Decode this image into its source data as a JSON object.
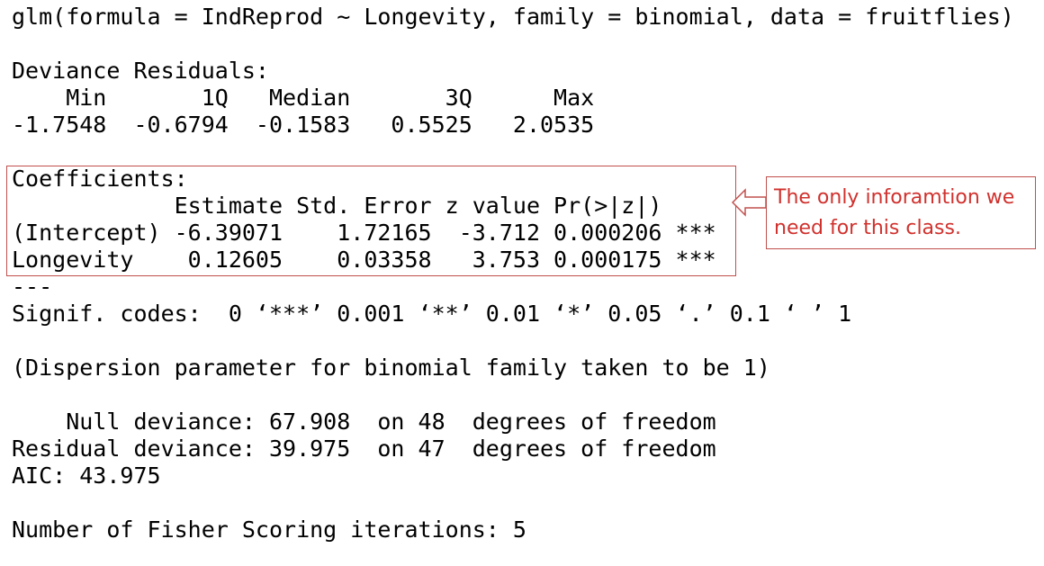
{
  "console": {
    "lines": [
      "glm(formula = IndReprod ~ Longevity, family = binomial, data = fruitflies)",
      "",
      "Deviance Residuals:",
      "    Min       1Q   Median       3Q      Max",
      "-1.7548  -0.6794  -0.1583   0.5525   2.0535",
      "",
      "Coefficients:",
      "            Estimate Std. Error z value Pr(>|z|)",
      "(Intercept) -6.39071    1.72165  -3.712 0.000206 ***",
      "Longevity    0.12605    0.03358   3.753 0.000175 ***",
      "---",
      "Signif. codes:  0 ‘***’ 0.001 ‘**’ 0.01 ‘*’ 0.05 ‘.’ 0.1 ‘ ’ 1",
      "",
      "(Dispersion parameter for binomial family taken to be 1)",
      "",
      "    Null deviance: 67.908  on 48  degrees of freedom",
      "Residual deviance: 39.975  on 47  degrees of freedom",
      "AIC: 43.975",
      "",
      "Number of Fisher Scoring iterations: 5"
    ]
  },
  "annotation": {
    "lines": [
      "The only inforamtion we",
      "need for this class."
    ]
  },
  "colors": {
    "annotation_border": "#c0504d",
    "annotation_text": "#d0312d"
  }
}
